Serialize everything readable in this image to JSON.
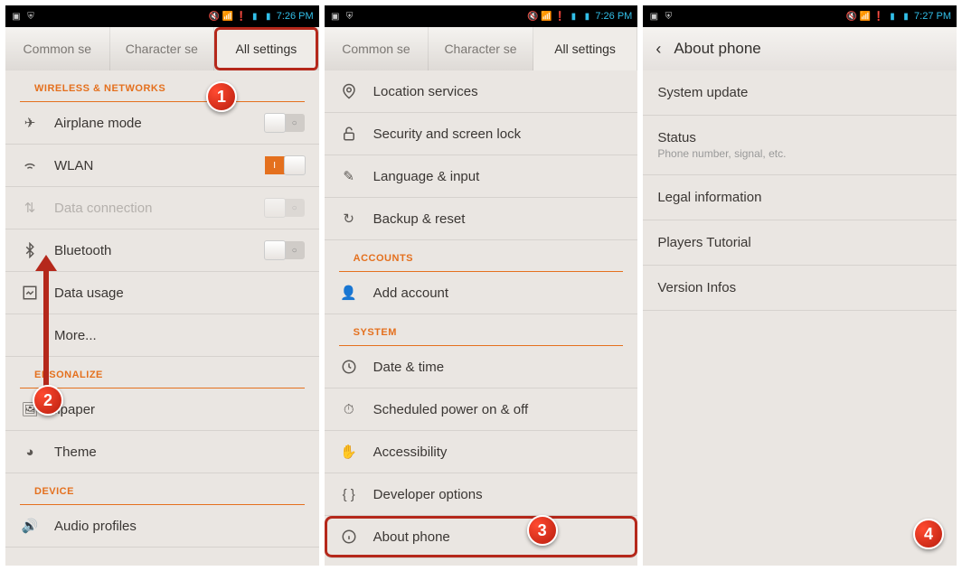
{
  "statusbar": {
    "time1": "7:26 PM",
    "time2": "7:26 PM",
    "time3": "7:27 PM"
  },
  "tabs": {
    "common": "Common se",
    "character": "Character se",
    "all": "All settings"
  },
  "s1": {
    "sec_wireless": "WIRELESS & NETWORKS",
    "airplane": "Airplane mode",
    "wlan": "WLAN",
    "data": "Data connection",
    "bluetooth": "Bluetooth",
    "usage": "Data usage",
    "more": "More...",
    "sec_personalize": "ERSONALIZE",
    "wallpaper": "llpaper",
    "theme": "Theme",
    "sec_device": "DEVICE",
    "audio": "Audio profiles"
  },
  "s2": {
    "location": "Location services",
    "security": "Security and screen lock",
    "language": "Language & input",
    "backup": "Backup & reset",
    "sec_accounts": "ACCOUNTS",
    "add_account": "Add account",
    "sec_system": "SYSTEM",
    "datetime": "Date & time",
    "scheduled": "Scheduled power on & off",
    "accessibility": "Accessibility",
    "developer": "Developer options",
    "about": "About phone"
  },
  "s3": {
    "title": "About phone",
    "update": "System update",
    "status": "Status",
    "status_sub": "Phone number, signal, etc.",
    "legal": "Legal information",
    "tutorial": "Players Tutorial",
    "version": "Version Infos"
  },
  "badges": {
    "b1": "1",
    "b2": "2",
    "b3": "3",
    "b4": "4"
  }
}
